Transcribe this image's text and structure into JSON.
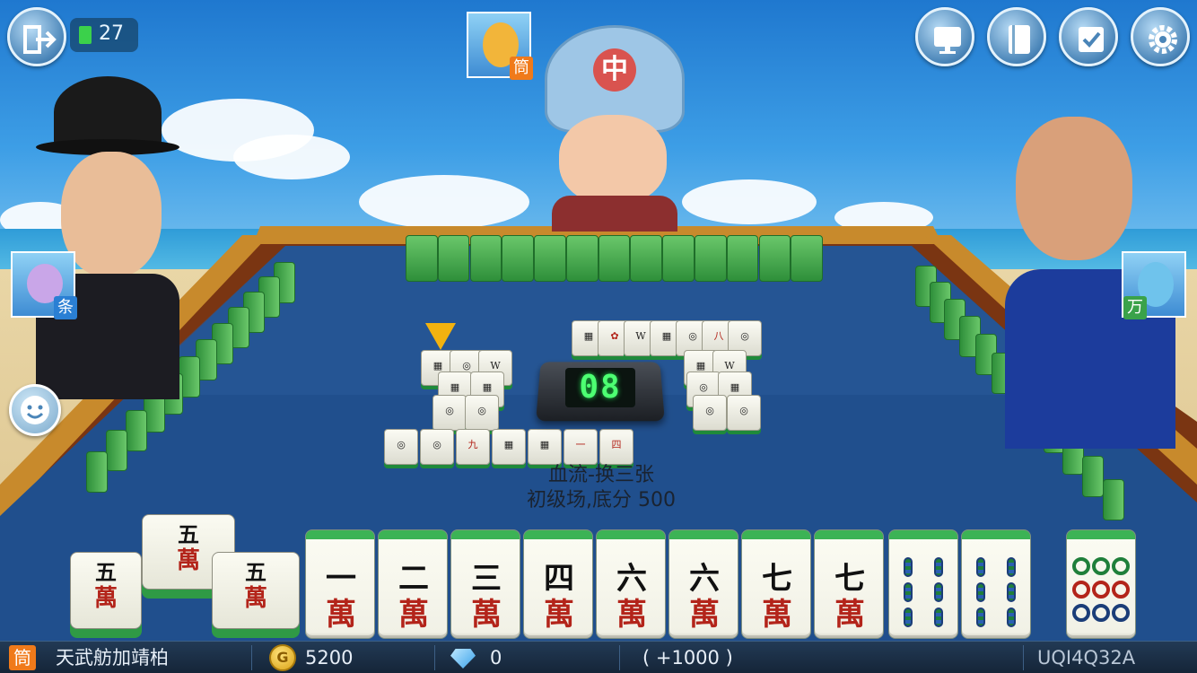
{
  "battery": {
    "level": "27"
  },
  "players": {
    "top": {
      "suit": "筒"
    },
    "left": {
      "suit": "条"
    },
    "right": {
      "suit": "万"
    }
  },
  "timer": "08",
  "room": {
    "mode": "血流-换三张",
    "level": "初级场,底分 500"
  },
  "hand": [
    {
      "top": "一",
      "bottom": "萬"
    },
    {
      "top": "二",
      "bottom": "萬"
    },
    {
      "top": "三",
      "bottom": "萬"
    },
    {
      "top": "四",
      "bottom": "萬"
    },
    {
      "top": "六",
      "bottom": "萬"
    },
    {
      "top": "六",
      "bottom": "萬"
    },
    {
      "top": "七",
      "bottom": "萬"
    },
    {
      "top": "七",
      "bottom": "萬"
    },
    {
      "top": "",
      "bottom": ""
    },
    {
      "top": "",
      "bottom": ""
    }
  ],
  "melds": [
    {
      "top": "五",
      "bottom": "萬"
    },
    {
      "top": "五",
      "bottom": "萬"
    },
    {
      "top": "五",
      "bottom": "萬"
    }
  ],
  "discards": {
    "row_labels": [
      "九",
      "一",
      "四",
      "八"
    ]
  },
  "bottom_bar": {
    "suit": "筒",
    "player_name": "天武舫加靖柏",
    "coins": "5200",
    "diamonds": "0",
    "bonus": "( +1000 )",
    "room_code": "UQI4Q32A"
  },
  "icons": {
    "exit": "exit-icon",
    "monitor": "monitor-icon",
    "notebook": "notebook-icon",
    "tasks": "checkbox-icon",
    "settings": "gear-icon",
    "emoji": "emoji-icon",
    "coin": "coin-icon",
    "diamond": "diamond-icon"
  },
  "colors": {
    "felt": "#1f4f8a",
    "tile_back": "#3cb355",
    "timer_digits": "#4dff72",
    "suit_tong": "#f07a1a",
    "suit_tiao": "#2a7fd4",
    "suit_wan": "#3aa24a"
  }
}
